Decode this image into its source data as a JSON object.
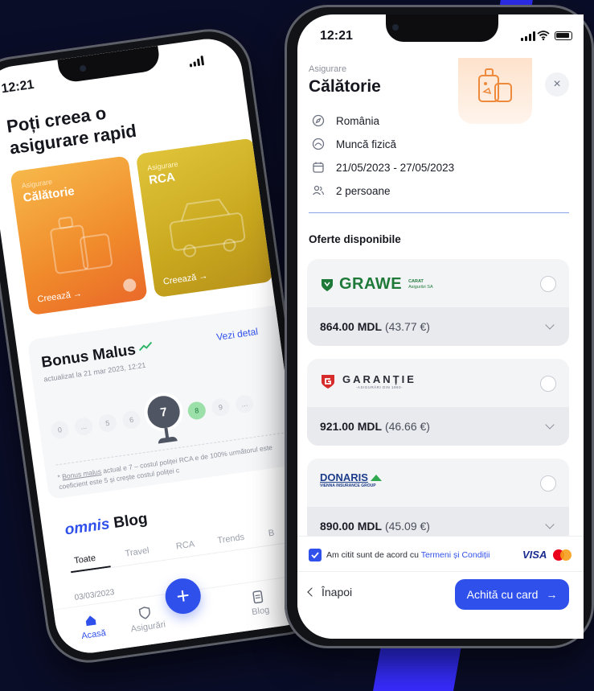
{
  "back_phone": {
    "status_time": "12:21",
    "heading": "Poți creea o asigurare rapid",
    "cards": [
      {
        "small": "Asigurare",
        "title": "Călătorie",
        "cta": "Creează →"
      },
      {
        "small": "Asigurare",
        "title": "RCA",
        "cta": "Creează →"
      }
    ],
    "bonus": {
      "title": "Bonus Malus",
      "see_details": "Vezi detal",
      "updated": "actualizat la 21 mar 2023, 12:21",
      "scale": [
        "0",
        "...",
        "5",
        "6",
        "7",
        "8",
        "9",
        "..."
      ],
      "current": "7",
      "note_link": "Bonus malus",
      "note": "actual e 7 – costul poliței RCA e de 100% următorul este coeficient este 5 și crește costul poliței c"
    },
    "blog": {
      "brand": "omnis",
      "title": "Blog",
      "tabs": [
        "Toate",
        "Travel",
        "RCA",
        "Trends",
        "B"
      ],
      "date": "03/03/2023"
    },
    "nav": {
      "home": "Acasă",
      "insurance": "Asigurări",
      "blog": "Blog"
    }
  },
  "front_phone": {
    "status_time": "12:21",
    "subtitle": "Asigurare",
    "title": "Călătorie",
    "details": [
      {
        "icon": "compass-icon",
        "text": "România"
      },
      {
        "icon": "work-icon",
        "text": "Muncă fizică"
      },
      {
        "icon": "calendar-icon",
        "text": "21/05/2023 - 27/05/2023"
      },
      {
        "icon": "people-icon",
        "text": "2 persoane"
      }
    ],
    "offers_heading": "Oferte disponibile",
    "offers": [
      {
        "brand": "GRAWE",
        "brand_sub_1": "CARAT",
        "brand_sub_2": "Asigurări SA",
        "price": "864.00 MDL",
        "price_eur": "(43.77 €)",
        "color": "#1f7a3a"
      },
      {
        "brand": "GARANȚIE",
        "brand_sub_1": "-ASIGURĂRI DIN 1993-",
        "price": "921.00 MDL",
        "price_eur": "(46.66 €)",
        "color": "#d62b2b"
      },
      {
        "brand": "DONARIS",
        "brand_sub_1": "VIENNA INSURANCE GROUP",
        "price": "890.00 MDL",
        "price_eur": "(45.09 €)",
        "color": "#1c3d8a"
      }
    ],
    "terms_prefix": "Am citit sunt de acord cu",
    "terms_link": "Termeni și Condiții",
    "visa": "VISA",
    "back_label": "Înapoi",
    "pay_label": "Achită cu card",
    "colors": {
      "accent": "#2f50ea",
      "card_orange": "#f09a2c",
      "card_gold": "#c9a81e"
    }
  }
}
